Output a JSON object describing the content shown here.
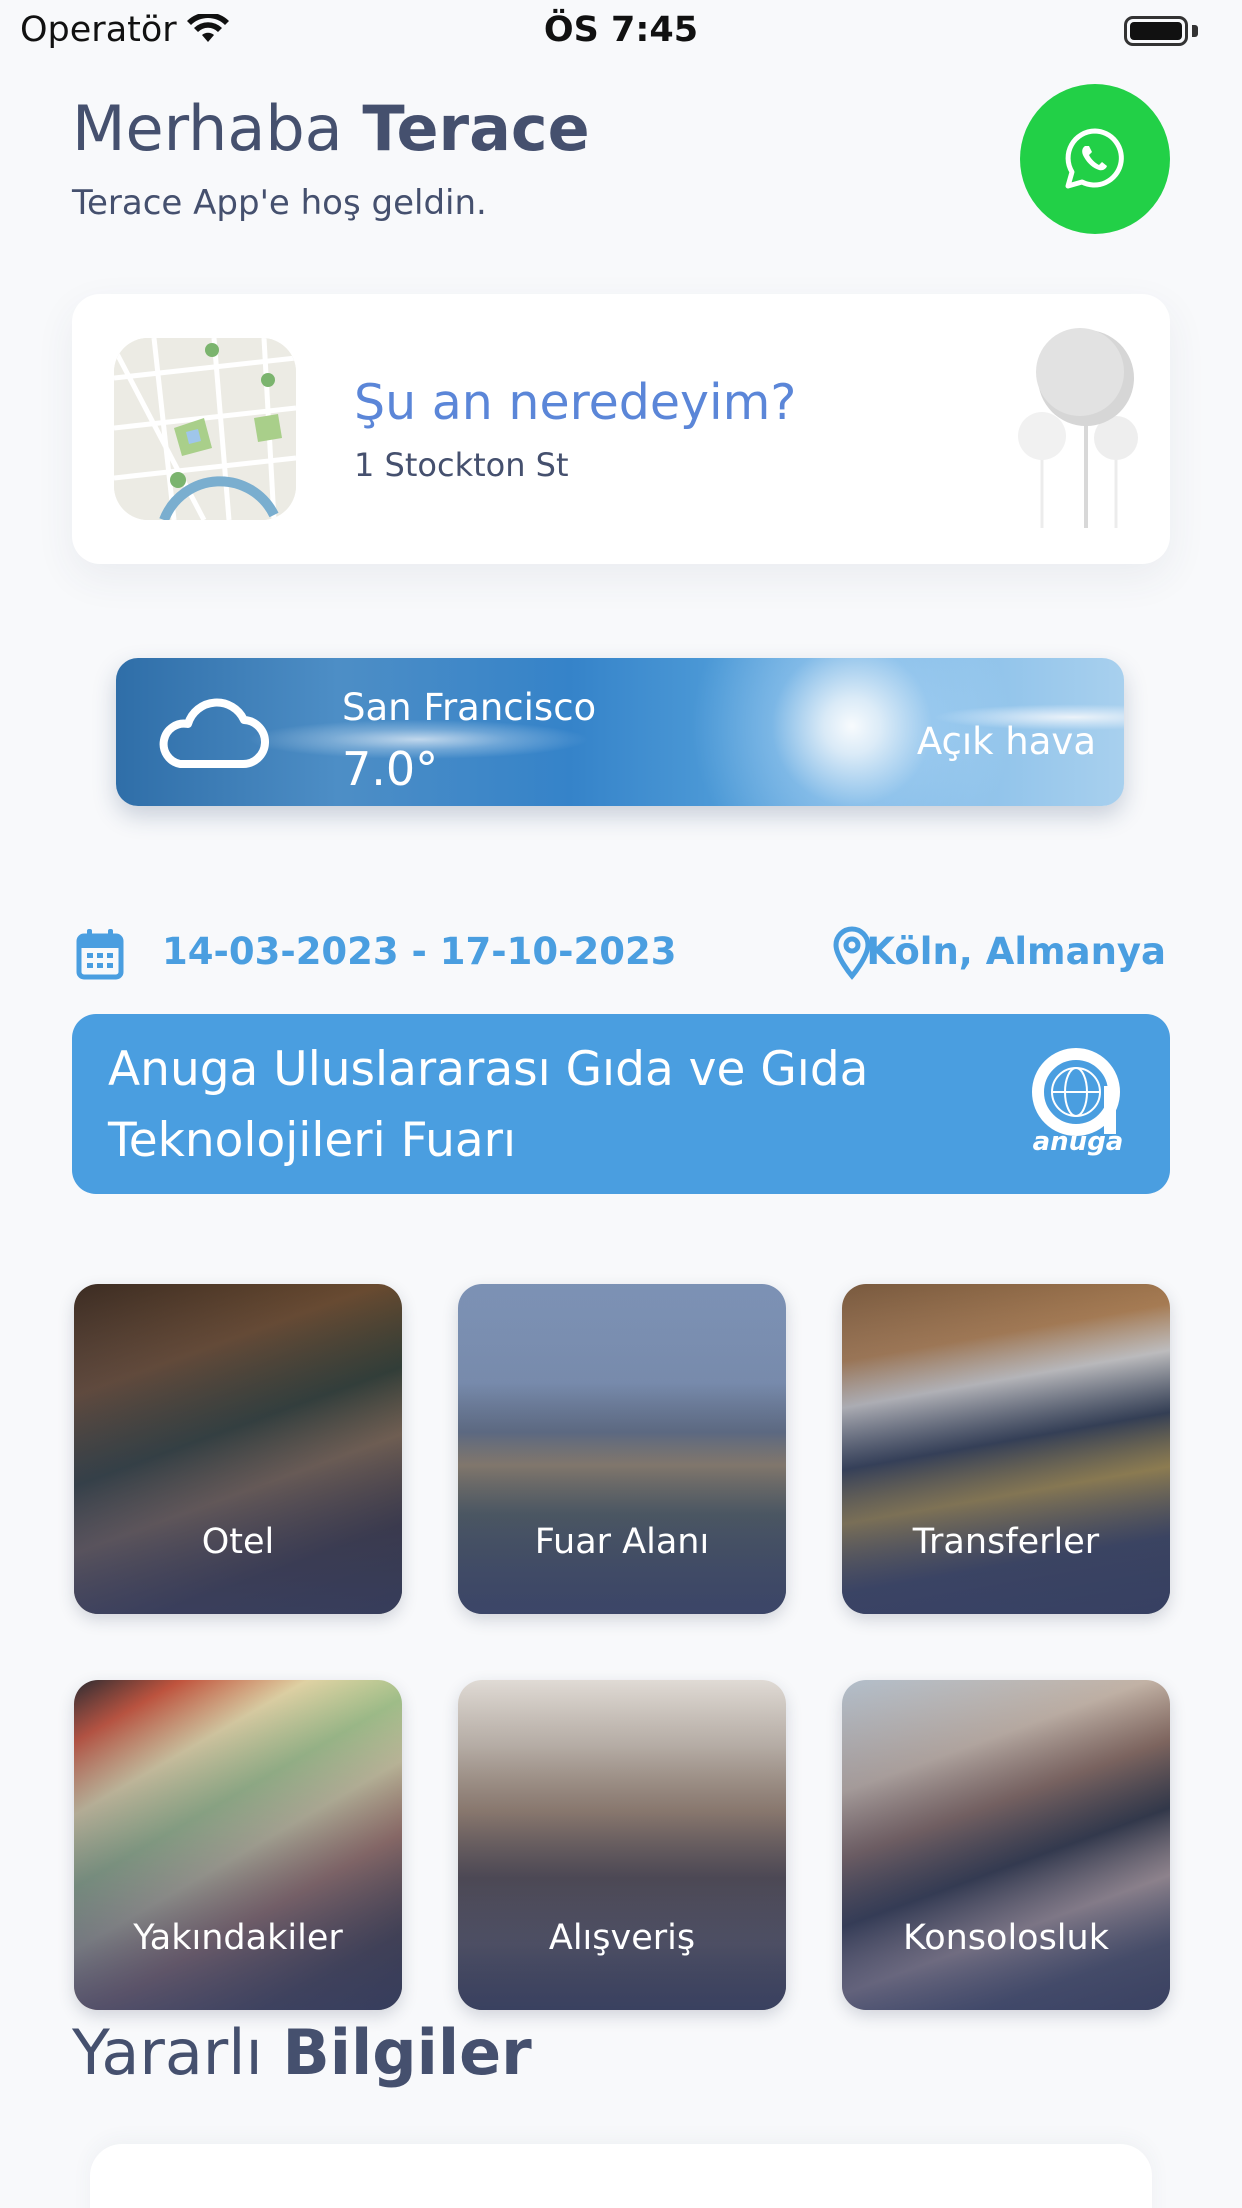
{
  "status_bar": {
    "carrier": "Operatör",
    "time": "ÖS 7:45",
    "battery_level": 1.0
  },
  "header": {
    "greeting_prefix": "Merhaba",
    "greeting_name": "Terace",
    "subtitle": "Terace App'e hoş geldin.",
    "whatsapp_icon": "whatsapp-icon",
    "whatsapp_color": "#22d047"
  },
  "location_card": {
    "title": "Şu an neredeyim?",
    "address": "1 Stockton St"
  },
  "weather": {
    "city": "San Francisco",
    "temperature": "7.0°",
    "description": "Açık hava",
    "icon": "cloud-icon"
  },
  "event": {
    "dates": "14-03-2023 - 17-10-2023",
    "location": "Köln, Almanya",
    "title": "Anuga Uluslararası Gıda ve Gıda Teknolojileri Fuarı",
    "logo_text": "anuga",
    "accent_color": "#4a9ee0"
  },
  "tiles": [
    {
      "label": "Otel"
    },
    {
      "label": "Fuar Alanı"
    },
    {
      "label": "Transferler"
    },
    {
      "label": "Yakındakiler"
    },
    {
      "label": "Alışveriş"
    },
    {
      "label": "Konsolosluk"
    }
  ],
  "useful_info": {
    "title_light": "Yararlı",
    "title_bold": "Bilgiler"
  }
}
